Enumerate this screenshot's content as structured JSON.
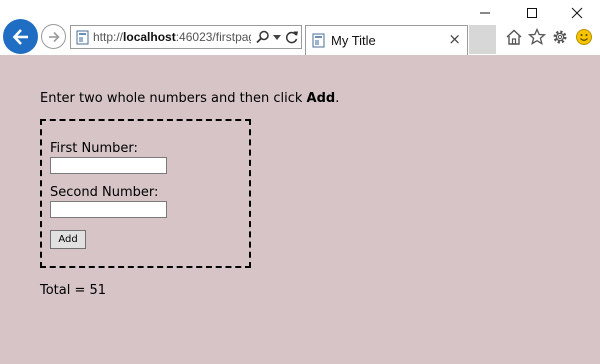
{
  "browser": {
    "url_plain": "http://",
    "url_host": "localhost",
    "url_rest": ":46023/firstpag",
    "tab_title": "My Title",
    "tab_close": "×"
  },
  "page": {
    "instruction_prefix": "Enter two whole numbers and then click ",
    "instruction_bold": "Add",
    "instruction_suffix": ".",
    "first_label": "First Number:",
    "first_value": "",
    "second_label": "Second Number:",
    "second_value": "",
    "add_button": "Add",
    "total_label": "Total = ",
    "total_value": "51",
    "background_color": "#d6c4c6"
  }
}
